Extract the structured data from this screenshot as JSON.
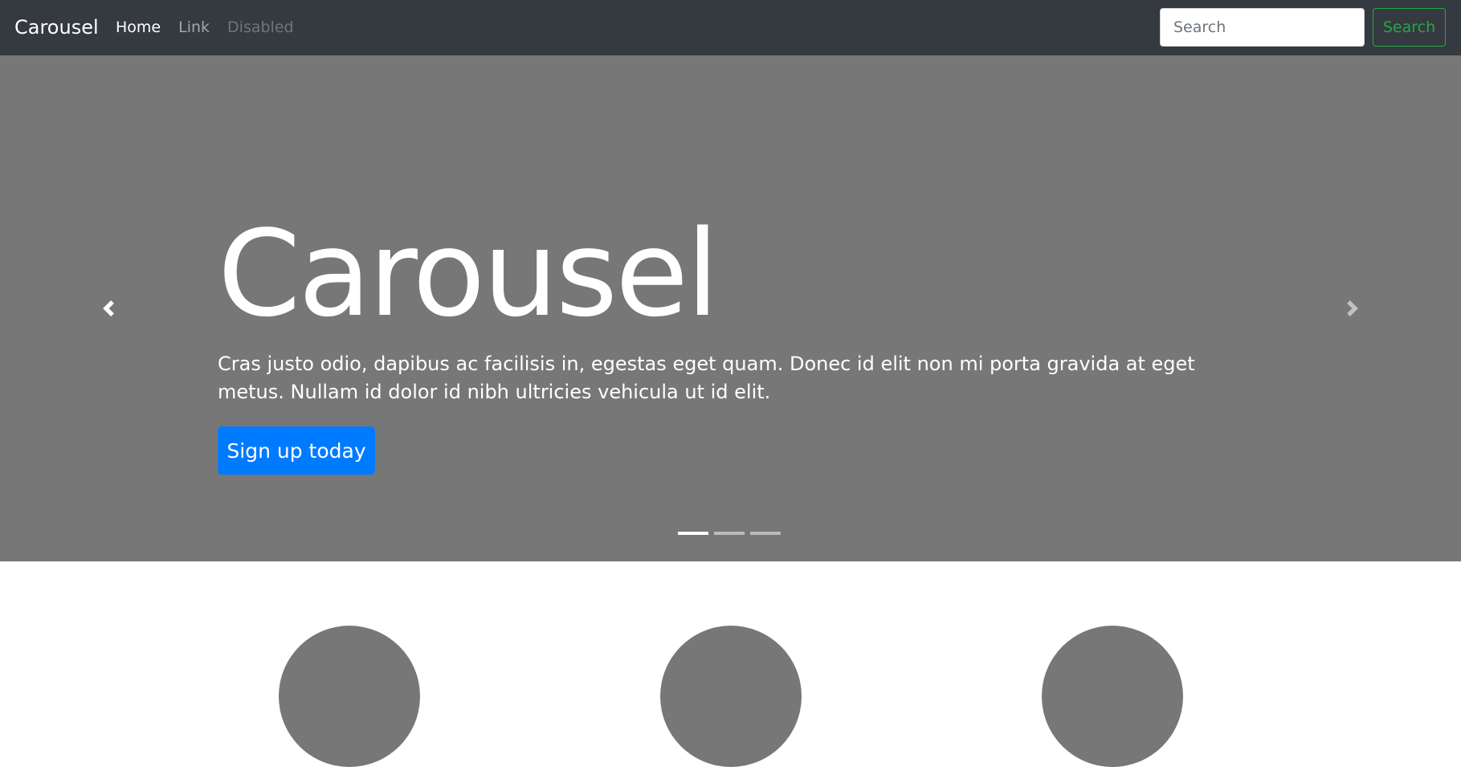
{
  "navbar": {
    "brand": "Carousel",
    "links": [
      {
        "label": "Home",
        "state": "active"
      },
      {
        "label": "Link",
        "state": "normal"
      },
      {
        "label": "Disabled",
        "state": "disabled"
      }
    ],
    "search": {
      "placeholder": "Search",
      "value": "",
      "button_label": "Search"
    }
  },
  "carousel": {
    "title": "Carousel",
    "text": "Cras justo odio, dapibus ac facilisis in, egestas eget quam. Donec id elit non mi porta gravida at eget metus. Nullam id dolor id nibh ultricies vehicula ut id elit.",
    "button_label": "Sign up today",
    "slide_count": 3,
    "active_slide": 1
  },
  "icons": {
    "prev": "chevron-left-icon",
    "next": "chevron-right-icon"
  },
  "colors": {
    "navbar_bg": "#343a40",
    "carousel_bg": "#777777",
    "primary": "#007bff",
    "success": "#28a745",
    "placeholder_circle": "#777777"
  }
}
